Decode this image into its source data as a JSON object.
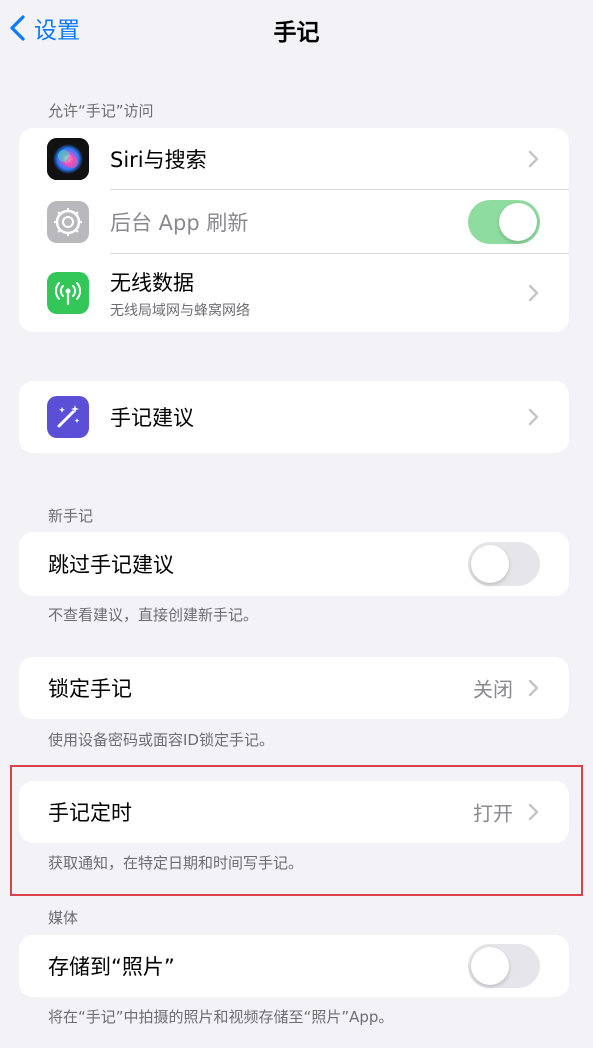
{
  "nav": {
    "back_label": "设置",
    "title": "手记"
  },
  "access": {
    "header": "允许“手记”访问",
    "siri": {
      "label": "Siri与搜索",
      "icon": "siri-icon"
    },
    "background_refresh": {
      "label": "后台 App 刷新",
      "icon": "gear-icon",
      "enabled": true,
      "disabled_style": true
    },
    "wireless": {
      "label": "无线数据",
      "sublabel": "无线局域网与蜂窝网络",
      "icon": "antenna-icon"
    }
  },
  "suggestions": {
    "label": "手记建议",
    "icon": "magic-wand-icon"
  },
  "new_entries": {
    "header": "新手记",
    "skip": {
      "label": "跳过手记建议",
      "enabled": false
    },
    "footer": "不查看建议，直接创建新手记。"
  },
  "lock": {
    "label": "锁定手记",
    "value": "关闭",
    "footer": "使用设备密码或面容ID锁定手记。"
  },
  "schedule": {
    "label": "手记定时",
    "value": "打开",
    "footer": "获取通知，在特定日期和时间写手记。"
  },
  "media": {
    "header": "媒体",
    "save": {
      "label": "存储到“照片”",
      "enabled": false
    },
    "footer": "将在“手记”中拍摄的照片和视频存储至“照片”App。"
  },
  "colors": {
    "accent": "#0a7aff",
    "toggle_on": "#8fdca0",
    "highlight": "#d9434a",
    "background": "#f2f2f7"
  }
}
